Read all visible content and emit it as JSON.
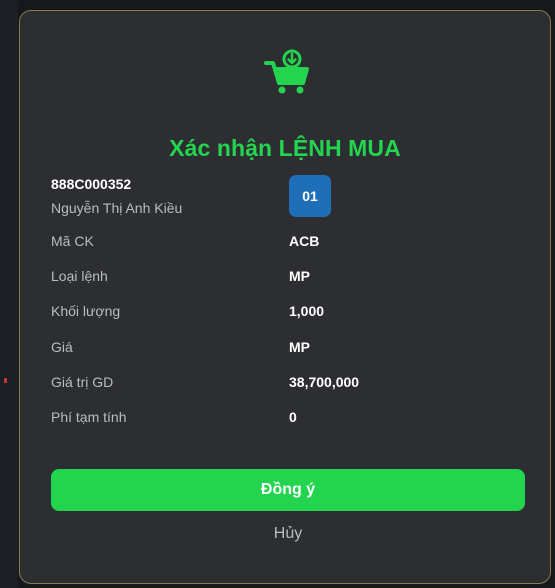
{
  "colors": {
    "accent_green": "#23d44f",
    "badge_blue": "#1f6fb8",
    "modal_bg": "#2d2e31"
  },
  "dialog": {
    "icon": "shopping-cart-download-icon",
    "title": "Xác nhận LỆNH MUA"
  },
  "account": {
    "id": "888C000352",
    "name": "Nguyễn Thị Anh Kiều",
    "sub_account": "01"
  },
  "details": [
    {
      "label": "Mã CK",
      "value": "ACB"
    },
    {
      "label": "Loại lệnh",
      "value": "MP"
    },
    {
      "label": "Khối lượng",
      "value": "1,000"
    },
    {
      "label": "Giá",
      "value": "MP"
    },
    {
      "label": "Giá trị GD",
      "value": "38,700,000"
    },
    {
      "label": "Phí tạm tính",
      "value": "0"
    }
  ],
  "actions": {
    "confirm_label": "Đồng ý",
    "cancel_label": "Hủy"
  }
}
